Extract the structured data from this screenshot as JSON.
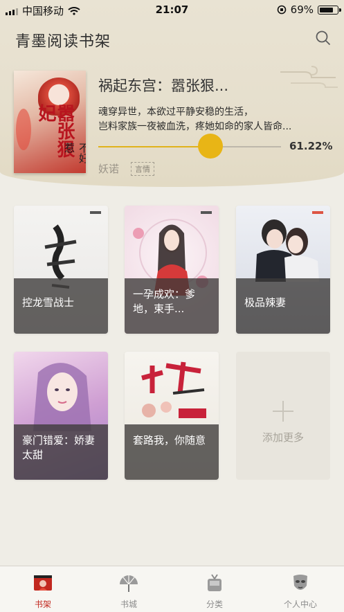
{
  "status_bar": {
    "carrier": "中国移动",
    "time": "21:07",
    "battery_percent": "69%"
  },
  "header": {
    "title": "青墨阅读书架"
  },
  "current_book": {
    "title": "祸起东宫：嚣张狠...",
    "description_line1": "魂穿异世，本欲过平静安稳的生活，",
    "description_line2": "岂料家族一夜被血洗，疼她如命的家人皆命...",
    "progress_text": "61.22%",
    "progress": 0.6122,
    "author": "妖诺",
    "tag": "言情",
    "cover_title_text": "嚣张狠妃",
    "cover_subtitle_text": "不好惹"
  },
  "shelf": [
    {
      "title": "控龙雪战士"
    },
    {
      "title": "一孕成欢：爹地，束手..."
    },
    {
      "title": "极品辣妻"
    },
    {
      "title": "豪门错爱：娇妻太甜"
    },
    {
      "title": "套路我，你随意"
    }
  ],
  "add_more": {
    "label": "添加更多"
  },
  "tabs": [
    {
      "label": "书架"
    },
    {
      "label": "书城"
    },
    {
      "label": "分类"
    },
    {
      "label": "个人中心"
    }
  ],
  "colors": {
    "accent": "#e8b516",
    "active_tab": "#c2281f",
    "background": "#efede6"
  }
}
